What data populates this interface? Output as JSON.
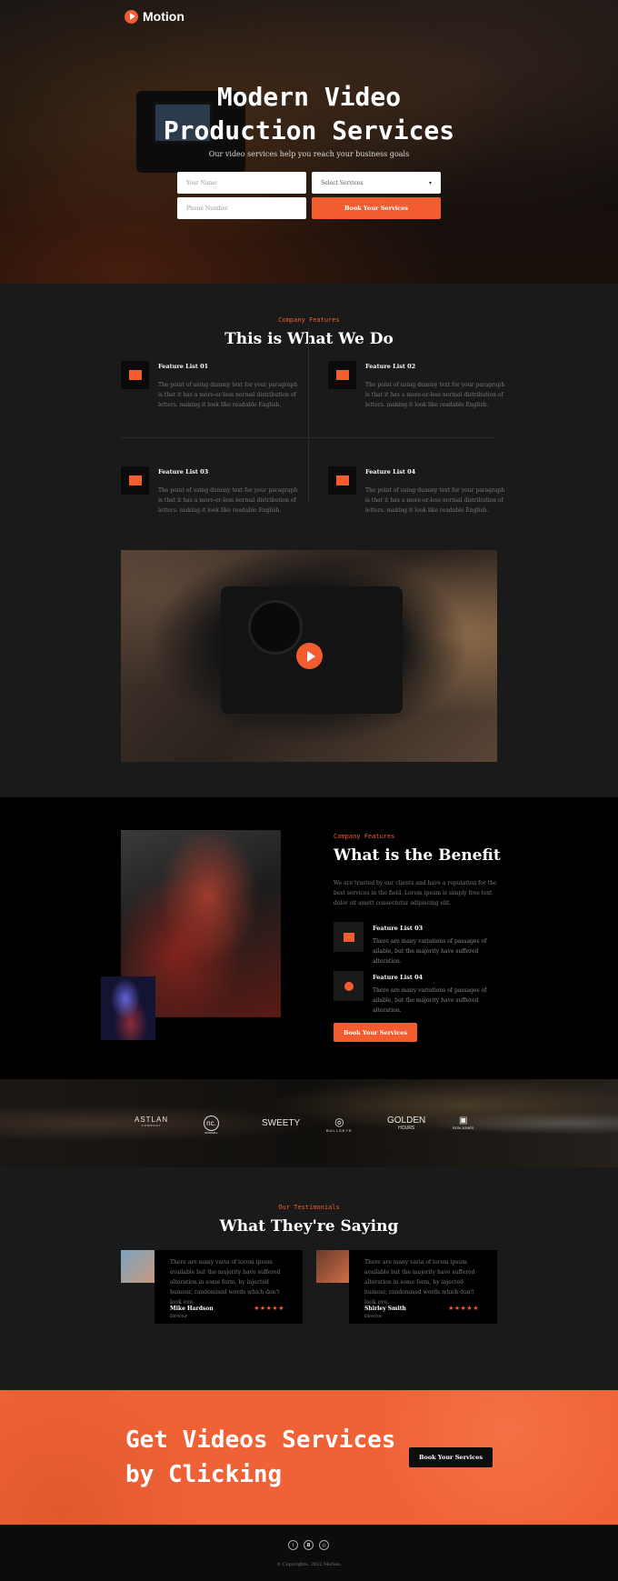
{
  "brand": {
    "name": "Motion"
  },
  "hero": {
    "title_line1": "Modern Video",
    "title_line2": "Production Services",
    "subtitle": "Our video services help you reach your business goals",
    "name_placeholder": "Your Name",
    "service_select": "Select Services",
    "phone_placeholder": "Phone Number",
    "cta": "Book Your Services"
  },
  "features": {
    "eyebrow": "Company Features",
    "title": "This is What We Do",
    "items": [
      {
        "title": "Feature List 01",
        "text": "The point of using dummy text for your paragraph is that it has a more-or-less normal distribution of letters. making it look like readable English."
      },
      {
        "title": "Feature List 02",
        "text": "The point of using dummy text for your paragraph is that it has a more-or-less normal distribution of letters. making it look like readable English."
      },
      {
        "title": "Feature List 03",
        "text": "The point of using dummy text for your paragraph is that it has a more-or-less normal distribution of letters. making it look like readable English."
      },
      {
        "title": "Feature List 04",
        "text": "The point of using dummy text for your paragraph is that it has a more-or-less normal distribution of letters. making it look like readable English."
      }
    ]
  },
  "benefit": {
    "eyebrow": "Company Features",
    "title": "What is the Benefit",
    "text": "We are trusted by our clients and have a reputation for the best services in the field. Lorem ipsum is simply free text dolor sit amett consectetur adipiscing elit.",
    "items": [
      {
        "title": "Feature List 03",
        "text": "There are many variations of passages of ailable, but the majority have suffered alteration."
      },
      {
        "title": "Feature List 04",
        "text": "There are many variations of passages of ailable, but the majority have suffered alteration."
      }
    ],
    "cta": "Book Your Services"
  },
  "logos": [
    {
      "main": "ASTLAN",
      "sub": "COMPANY"
    },
    {
      "main": "nc.",
      "sub": "WINDMILL"
    },
    {
      "main": "SWEETY",
      "sub": ""
    },
    {
      "main": "◎",
      "sub": "BULLSEYE"
    },
    {
      "main": "GOLDEN",
      "sub": "HOURS"
    },
    {
      "main": "▣",
      "sub": "RON JONES"
    }
  ],
  "testimonials": {
    "eyebrow": "Our Testimonials",
    "title": "What They're Saying",
    "items": [
      {
        "text": "There are many varia of lorem ipsum available but the majority have suffered alteration in some form, by injected humour, randomised words which don't look eve.",
        "name": "Mike Hardson",
        "role": "Director",
        "stars": "★★★★★"
      },
      {
        "text": "There are many varia of lorem ipsum available but the majority have suffered alteration in some form, by injected humour, randomised words which don't look eve.",
        "name": "Shirley Smith",
        "role": "Director",
        "stars": "★★★★★"
      }
    ]
  },
  "cta": {
    "title_line1": "Get Videos Services",
    "title_line2": "by Clicking",
    "button": "Book Your Services"
  },
  "footer": {
    "social": [
      "twitter-icon",
      "instagram-icon",
      "dribbble-icon"
    ],
    "copyright": "© Copyrights. 2022 Motion."
  },
  "colors": {
    "accent": "#f25c2f",
    "dark": "#1a1a1a",
    "black": "#000000"
  }
}
